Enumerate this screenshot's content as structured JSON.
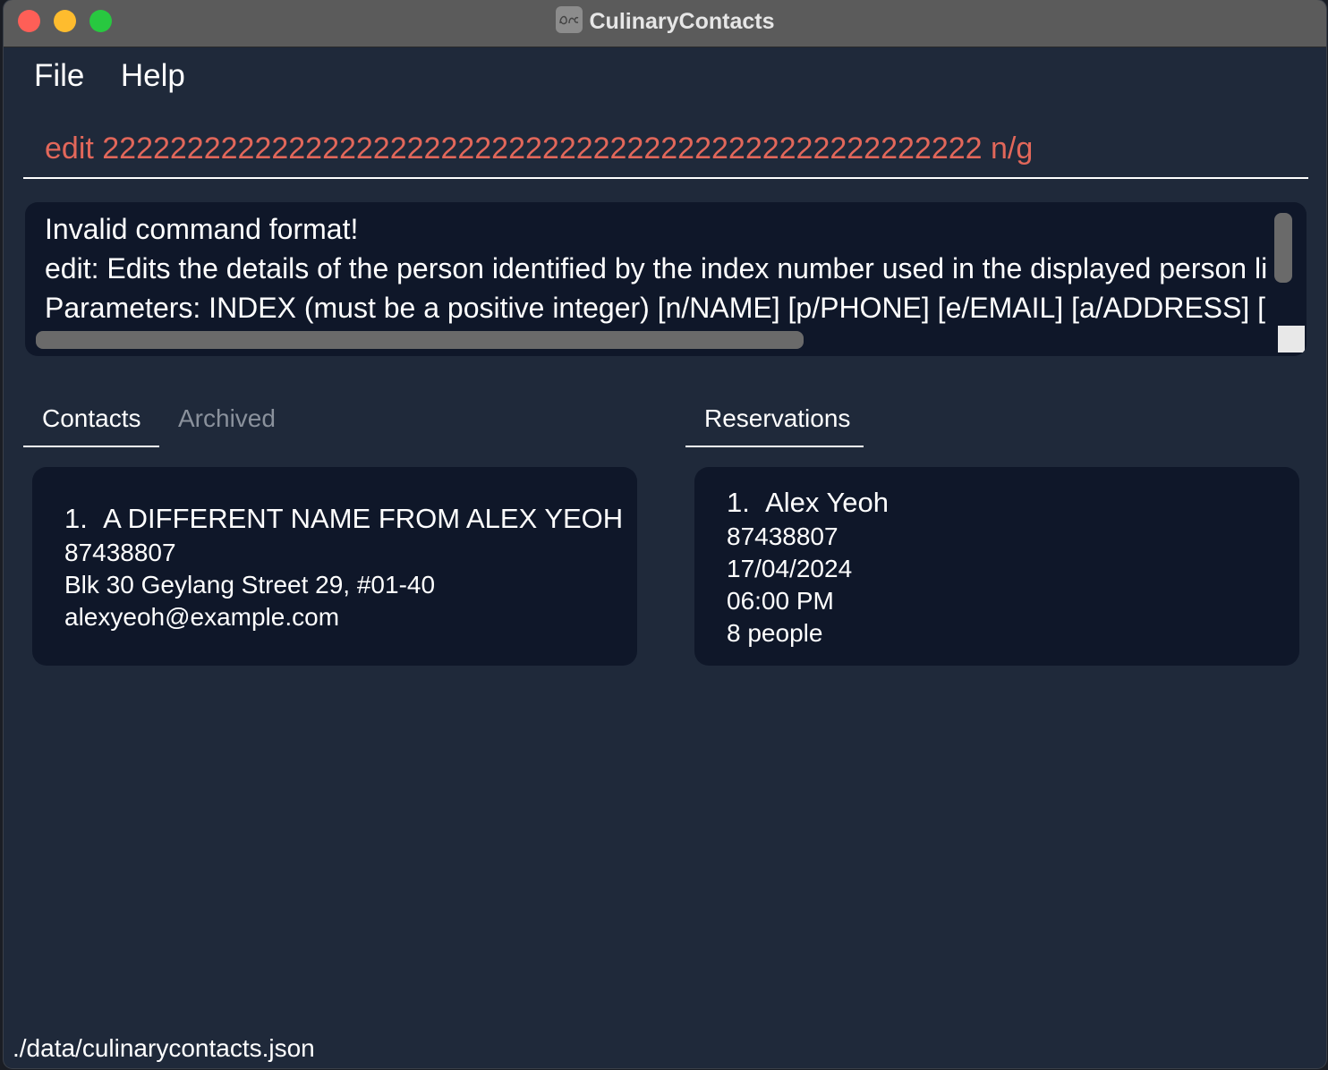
{
  "window": {
    "title": "CulinaryContacts",
    "controls": {
      "close": "close",
      "minimize": "minimize",
      "maximize": "zoom"
    }
  },
  "menu": {
    "items": [
      "File",
      "Help"
    ]
  },
  "command": {
    "value": "edit 2222222222222222222222222222222222222222222222222222 n/g"
  },
  "result": {
    "lines": [
      "Invalid command format!",
      "edit: Edits the details of the person identified by the index number used in the displayed person li",
      "Parameters: INDEX (must be a positive integer) [n/NAME] [p/PHONE] [e/EMAIL] [a/ADDRESS] ["
    ]
  },
  "left_panel": {
    "tabs": [
      {
        "label": "Contacts",
        "active": true
      },
      {
        "label": "Archived",
        "active": false
      }
    ],
    "cards": [
      {
        "index": "1.",
        "name": "A DIFFERENT NAME FROM ALEX YEOH",
        "phone": "87438807",
        "address": "Blk 30 Geylang Street 29, #01-40",
        "email": "alexyeoh@example.com"
      }
    ]
  },
  "right_panel": {
    "tabs": [
      {
        "label": "Reservations",
        "active": true
      }
    ],
    "cards": [
      {
        "index": "1.",
        "name": "Alex Yeoh",
        "phone": "87438807",
        "date": "17/04/2024",
        "time": "06:00 PM",
        "pax": "8 people"
      }
    ]
  },
  "status": {
    "file_path": "./data/culinarycontacts.json"
  },
  "colors": {
    "background": "#1f293a",
    "card": "#0f1729",
    "command_text": "#e2675a",
    "tab_inactive": "#8a919c"
  }
}
